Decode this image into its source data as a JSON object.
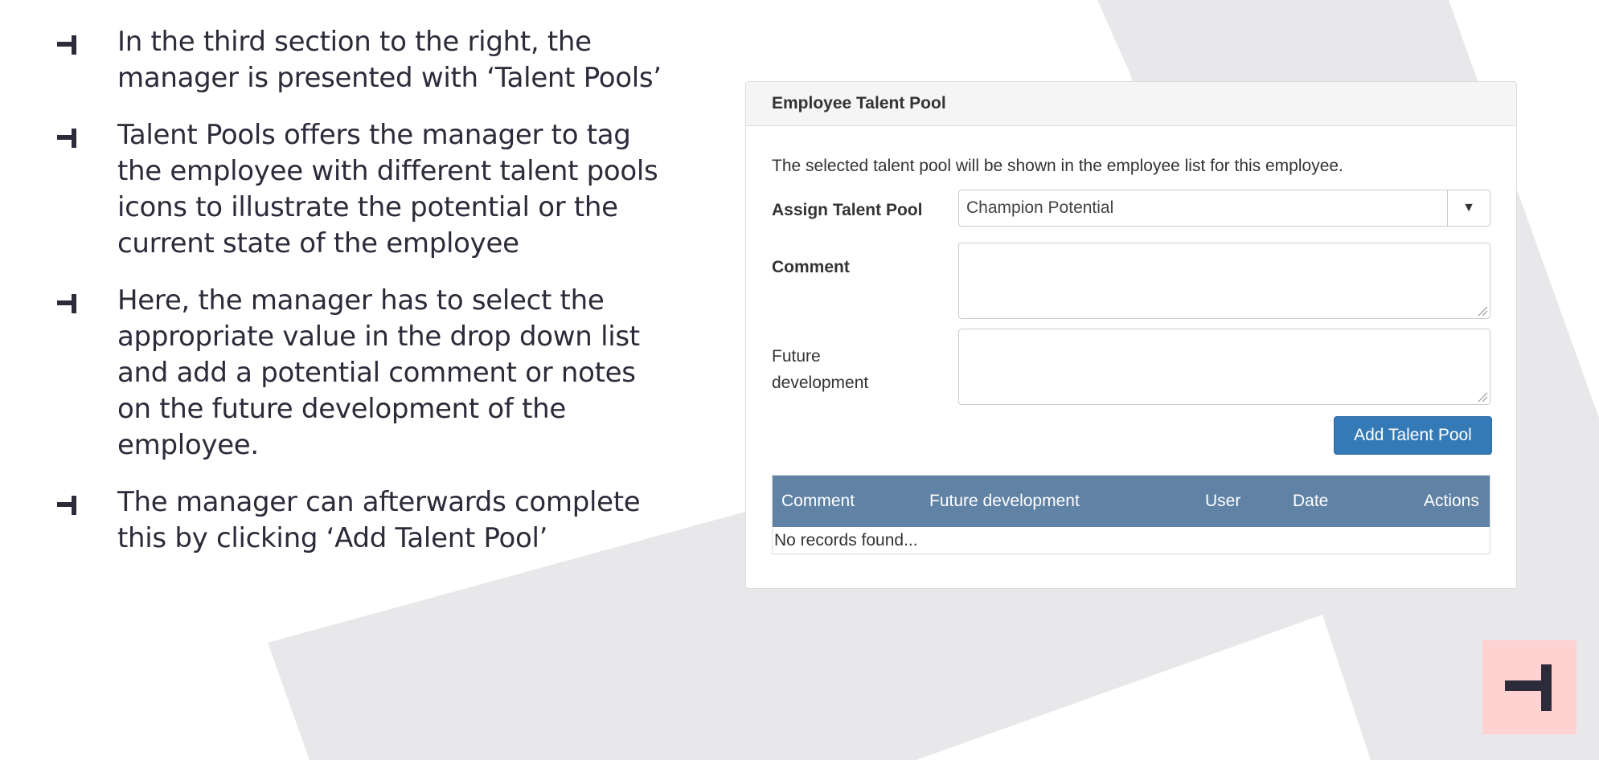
{
  "slide": {
    "bullets": [
      "In the third section to the right, the manager is presented with ‘Talent Pools’",
      "Talent Pools offers the manager to tag the employee with different talent pools icons to illustrate the potential or the current state of the employee",
      "Here, the manager has to select the appropriate value in the drop down list and add a potential comment or notes on the future development of the employee.",
      "The manager can afterwards complete this by clicking ‘Add Talent Pool’"
    ],
    "bullet_icon": "tee-bar-icon",
    "logo_icon": "tee-bar-logo-icon"
  },
  "panel": {
    "title": "Employee Talent Pool",
    "help_text": "The selected talent pool will be shown in the employee list for this employee.",
    "assign_label": "Assign Talent Pool",
    "assign_value": "Champion Potential",
    "comment_label": "Comment",
    "comment_value": "",
    "future_label_line1": "Future",
    "future_label_line2": "development",
    "future_value": "",
    "add_button": "Add Talent Pool",
    "table": {
      "headers": [
        "Comment",
        "Future development",
        "User",
        "Date",
        "Actions"
      ],
      "empty_text": "No records found..."
    }
  },
  "colors": {
    "accent_blue": "#337ab7",
    "table_header": "#5f82a5",
    "logo_bg": "#ffd2d2",
    "bullet_dark": "#2b2b3a",
    "bg_shape": "#e8e8ea"
  }
}
